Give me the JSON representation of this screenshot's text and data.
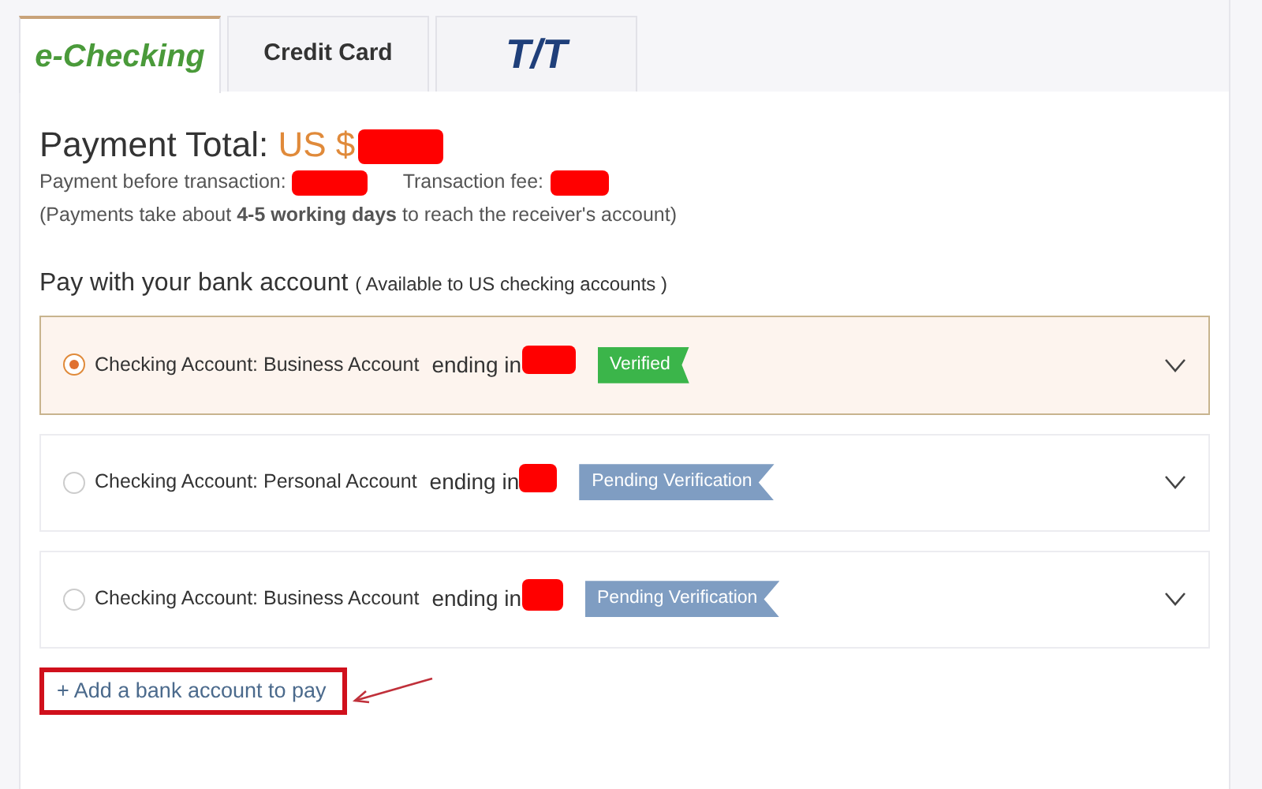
{
  "tabs": [
    {
      "label": "e-Checking",
      "selected": true,
      "kind": "text"
    },
    {
      "label": "Credit Card",
      "selected": false,
      "kind": "text"
    },
    {
      "label": "T/T",
      "selected": false,
      "kind": "logo"
    }
  ],
  "payment": {
    "total_label": "Payment Total:",
    "total_value": "US $",
    "before_label": "Payment before transaction:",
    "fee_label": "Transaction fee:",
    "note": "(Payments take about **4-5 working days** to reach the receiver's account)"
  },
  "section": {
    "title": "Pay with your bank account",
    "subtitle": "( Available to US checking accounts )"
  },
  "accounts": [
    {
      "name": "Checking Account: Business Account",
      "ending": "ending in",
      "status": "Verified",
      "kind": "verified",
      "selected": true
    },
    {
      "name": "Checking Account: Personal Account",
      "ending": "ending in",
      "status": "Pending Verification",
      "kind": "pending",
      "selected": false
    },
    {
      "name": "Checking Account: Business Account",
      "ending": "ending in",
      "status": "Pending Verification",
      "kind": "pending",
      "selected": false
    }
  ],
  "add_link": "+ Add a bank account to pay"
}
